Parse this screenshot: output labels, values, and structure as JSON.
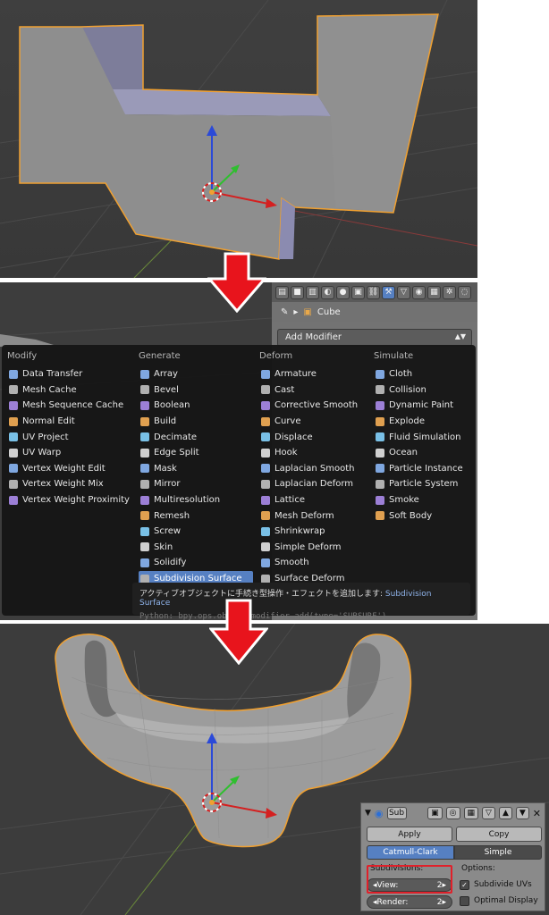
{
  "properties": {
    "object_name": "Cube",
    "add_modifier_label": "Add Modifier"
  },
  "menu": {
    "modify": {
      "header": "Modify",
      "items": [
        "Data Transfer",
        "Mesh Cache",
        "Mesh Sequence Cache",
        "Normal Edit",
        "UV Project",
        "UV Warp",
        "Vertex Weight Edit",
        "Vertex Weight Mix",
        "Vertex Weight Proximity"
      ]
    },
    "generate": {
      "header": "Generate",
      "items": [
        "Array",
        "Bevel",
        "Boolean",
        "Build",
        "Decimate",
        "Edge Split",
        "Mask",
        "Mirror",
        "Multiresolution",
        "Remesh",
        "Screw",
        "Skin",
        "Solidify",
        "Subdivision Surface"
      ]
    },
    "deform": {
      "header": "Deform",
      "items": [
        "Armature",
        "Cast",
        "Corrective Smooth",
        "Curve",
        "Displace",
        "Hook",
        "Laplacian Smooth",
        "Laplacian Deform",
        "Lattice",
        "Mesh Deform",
        "Shrinkwrap",
        "Simple Deform",
        "Smooth",
        "Surface Deform"
      ]
    },
    "simulate": {
      "header": "Simulate",
      "items": [
        "Cloth",
        "Collision",
        "Dynamic Paint",
        "Explode",
        "Fluid Simulation",
        "Ocean",
        "Particle Instance",
        "Particle System",
        "Smoke",
        "Soft Body"
      ]
    },
    "selected": "Subdivision Surface"
  },
  "tooltip": {
    "text": "アクティブオブジェクトに手続き型操作・エフェクトを追加します:",
    "highlight": "Subdivision Surface",
    "python": "Python: bpy.ops.object.modifier_add(type='SUBSURF')"
  },
  "subsurf_panel": {
    "name": "Sub",
    "apply_label": "Apply",
    "copy_label": "Copy",
    "algorithm_options": [
      "Catmull-Clark",
      "Simple"
    ],
    "selected_algorithm": "Catmull-Clark",
    "subdivisions_label": "Subdivisions:",
    "view_label": "View:",
    "view_value": "2",
    "render_label": "Render:",
    "render_value": "2",
    "options_label": "Options:",
    "subdivide_uvs_label": "Subdivide UVs",
    "subdivide_uvs_checked": true,
    "optimal_display_label": "Optimal Display",
    "optimal_display_checked": false
  },
  "colors": {
    "selection_outline": "#f0a030",
    "menu_highlight": "#5680c2",
    "arrow_red": "#e8141c",
    "highlight_box": "#e0202a"
  }
}
